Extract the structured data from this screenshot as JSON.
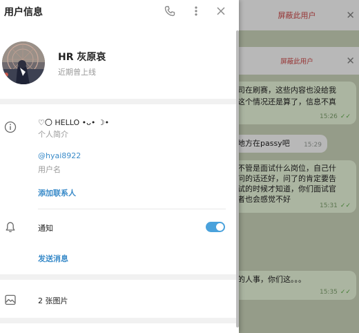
{
  "panel": {
    "title": "用户信息",
    "profile": {
      "name": "HR 灰原哀",
      "status": "近期曾上线"
    },
    "bio": {
      "value": "♡〇 HELLO •ᴗ• ☽•",
      "label": "个人简介"
    },
    "username": {
      "value": "@hyai8922",
      "label": "用户名"
    },
    "add_contact": "添加联系人",
    "notifications": {
      "label": "通知",
      "enabled": true
    },
    "send_message": "发送消息",
    "media": {
      "label": "2 张图片"
    }
  },
  "chat": {
    "block_bar": {
      "label": "屏蔽此用户"
    },
    "block_bar_secondary": {
      "label": "屏蔽此用户"
    },
    "messages": [
      {
        "line1": "司在刷赛，这些内容也没给我",
        "line2": "这个情况还是算了，信息不真",
        "time": "15:26",
        "read": true,
        "outgoing": true
      },
      {
        "line1": "地方在passy吧",
        "time": "15:29",
        "outgoing": false
      },
      {
        "line1": "不管是面试什么岗位，自己什",
        "line2": "问的话还好，问了的肯定要告",
        "line3": "试的时候才知道，你们面试官",
        "line4": "者也会感觉不好",
        "time": "15:31",
        "read": true,
        "outgoing": true
      },
      {
        "line1": "的人事，你们这。。。",
        "time": "15:35",
        "read": true,
        "outgoing": true
      }
    ]
  }
}
